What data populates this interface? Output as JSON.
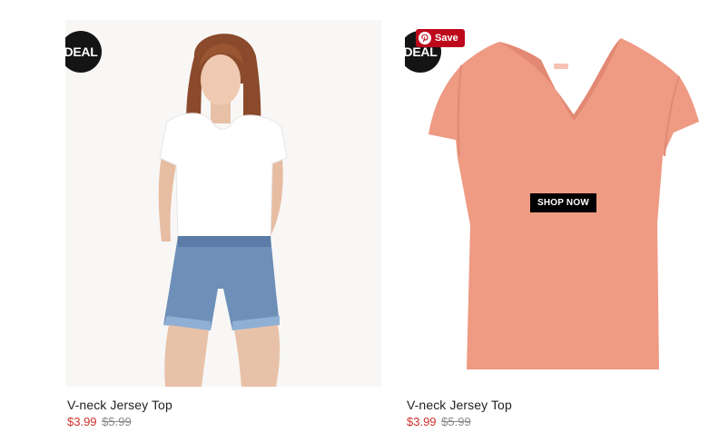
{
  "products": [
    {
      "badge": "DEAL",
      "name": "V-neck Jersey Top",
      "sale_price": "$3.99",
      "original_price": "$5.99",
      "image": "model-white-v-neck-top-denim-shorts"
    },
    {
      "badge": "DEAL",
      "name": "V-neck Jersey Top",
      "sale_price": "$3.99",
      "original_price": "$5.99",
      "image": "pink-v-neck-tshirt",
      "shop_now_label": "SHOP NOW",
      "pin_save_label": "Save"
    }
  ],
  "colors": {
    "sale_price": "#d0312d",
    "pinterest": "#bd081c",
    "badge": "#141414",
    "tshirt": "#ef9a83"
  }
}
